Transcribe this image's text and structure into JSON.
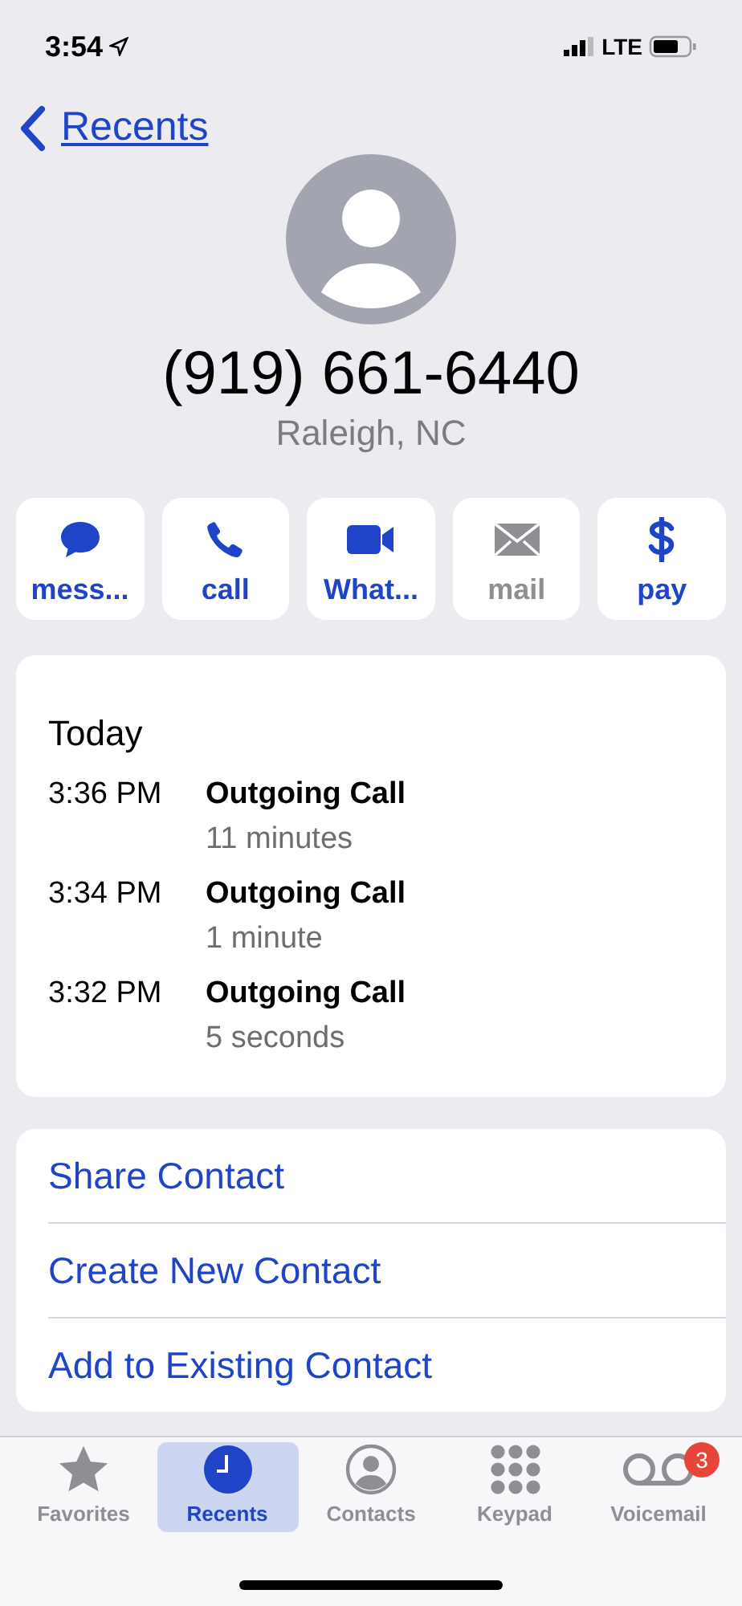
{
  "status_bar": {
    "time": "3:54",
    "network": "LTE"
  },
  "nav": {
    "back_label": "Recents"
  },
  "contact": {
    "number": "(919) 661-6440",
    "location": "Raleigh, NC"
  },
  "actions": [
    {
      "kind": "message",
      "label": "mess...",
      "disabled": false
    },
    {
      "kind": "call",
      "label": "call",
      "disabled": false
    },
    {
      "kind": "video",
      "label": "What...",
      "disabled": false
    },
    {
      "kind": "mail",
      "label": "mail",
      "disabled": true
    },
    {
      "kind": "pay",
      "label": "pay",
      "disabled": false
    }
  ],
  "history": {
    "heading": "Today",
    "calls": [
      {
        "time": "3:36 PM",
        "type": "Outgoing Call",
        "duration": "11 minutes"
      },
      {
        "time": "3:34 PM",
        "type": "Outgoing Call",
        "duration": "1 minute"
      },
      {
        "time": "3:32 PM",
        "type": "Outgoing Call",
        "duration": "5 seconds"
      }
    ]
  },
  "options": [
    "Share Contact",
    "Create New Contact",
    "Add to Existing Contact"
  ],
  "tabs": [
    {
      "kind": "favorites",
      "label": "Favorites",
      "selected": false
    },
    {
      "kind": "recents",
      "label": "Recents",
      "selected": true
    },
    {
      "kind": "contacts",
      "label": "Contacts",
      "selected": false
    },
    {
      "kind": "keypad",
      "label": "Keypad",
      "selected": false
    },
    {
      "kind": "voicemail",
      "label": "Voicemail",
      "selected": false,
      "badge": "3"
    }
  ]
}
